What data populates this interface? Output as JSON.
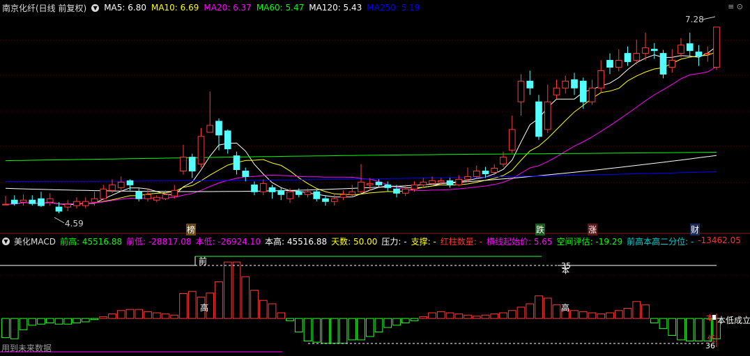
{
  "main_panel": {
    "stock_title": "南京化纤(日线 前复权)",
    "ma": [
      {
        "label": "MA5:",
        "value": "6.80",
        "color": "#ffffff"
      },
      {
        "label": "MA10:",
        "value": "6.69",
        "color": "#ffff00"
      },
      {
        "label": "MA20:",
        "value": "6.37",
        "color": "#ff00ff"
      },
      {
        "label": "MA60:",
        "value": "5.47",
        "color": "#00ff00"
      },
      {
        "label": "MA120:",
        "value": "5.43",
        "color": "#ffffff"
      },
      {
        "label": "MA250:",
        "value": "5.19",
        "color": "#0000ff"
      }
    ],
    "high_price_label": "7.28",
    "low_price_label": "4.59",
    "event_tags": [
      {
        "text": "榜",
        "color": "#ffffff",
        "bg": "#6b4a1a"
      },
      {
        "text": "跌",
        "color": "#ffffff",
        "bg": "#1a5a1a"
      },
      {
        "text": "涨",
        "color": "#ffffff",
        "bg": "#5a1a1a"
      },
      {
        "text": "财",
        "color": "#ffffff",
        "bg": "#1a2a5a"
      }
    ]
  },
  "macd_panel": {
    "title": "美化MACD",
    "metrics": [
      {
        "label": "前高:",
        "value": "45516.88",
        "color": "#00ff00"
      },
      {
        "label": "前低:",
        "value": "-28817.08",
        "color": "#ff00ff"
      },
      {
        "label": "本低:",
        "value": "-26924.10",
        "color": "#ff00ff"
      },
      {
        "label": "本高:",
        "value": "45516.88",
        "color": "#ffffff"
      },
      {
        "label": "天数:",
        "value": "50.00",
        "color": "#ffff00"
      },
      {
        "label": "压力:",
        "value": "-",
        "color": "#ffffff"
      },
      {
        "label": "支撑:",
        "value": "-",
        "color": "#ffff00"
      },
      {
        "label": "红柱数量:",
        "value": "-",
        "color": "#ff3030"
      },
      {
        "label": "横线起始价:",
        "value": "5.65",
        "color": "#ff00ff"
      },
      {
        "label": "空间评估:",
        "value": "-19.29",
        "color": "#00ff00"
      },
      {
        "label": "前高本高二分位:",
        "value": "-",
        "color": "#00d0d0"
      },
      {
        "label": "",
        "value": "-13462.05",
        "color": "#ff3030"
      }
    ],
    "annotations": {
      "qian": "前",
      "gao": "高",
      "ben": "本",
      "num_35": "35",
      "num_36": "36",
      "benchengli": "本低成立",
      "ben_small": "本",
      "di_small": "低"
    },
    "footer_note": "用到未来数据"
  },
  "window": {
    "controls": "≡ ⊙"
  },
  "chart_data": {
    "type": "candlestick",
    "y_ticks": [],
    "candles": [
      [
        4.72,
        4.72,
        4.84,
        4.72
      ],
      [
        4.78,
        4.73,
        4.85,
        4.7
      ],
      [
        4.75,
        4.78,
        4.86,
        4.7
      ],
      [
        4.78,
        4.73,
        4.85,
        4.7
      ],
      [
        4.8,
        4.7,
        4.9,
        4.68
      ],
      [
        4.75,
        4.8,
        4.88,
        4.7
      ],
      [
        4.68,
        4.62,
        4.75,
        4.59
      ],
      [
        4.68,
        4.72,
        4.78,
        4.62
      ],
      [
        4.7,
        4.76,
        4.82,
        4.66
      ],
      [
        4.7,
        4.76,
        4.82,
        4.66
      ],
      [
        4.75,
        4.8,
        4.9,
        4.7
      ],
      [
        4.8,
        4.94,
        5.0,
        4.78
      ],
      [
        4.92,
        5.0,
        5.08,
        4.88
      ],
      [
        4.96,
        5.04,
        5.12,
        4.9
      ],
      [
        5.06,
        5.0,
        5.08,
        4.92
      ],
      [
        4.9,
        4.8,
        4.95,
        4.76
      ],
      [
        4.8,
        4.86,
        4.95,
        4.76
      ],
      [
        4.78,
        4.82,
        4.85,
        4.75
      ],
      [
        4.8,
        4.86,
        4.92,
        4.78
      ],
      [
        4.84,
        4.92,
        5.0,
        4.8
      ],
      [
        5.2,
        5.4,
        5.58,
        5.15
      ],
      [
        5.4,
        5.2,
        5.45,
        5.1
      ],
      [
        5.3,
        5.7,
        5.82,
        5.25
      ],
      [
        5.76,
        5.86,
        6.35,
        5.8
      ],
      [
        5.92,
        5.72,
        5.96,
        5.5
      ],
      [
        5.78,
        5.52,
        5.8,
        5.45
      ],
      [
        5.42,
        5.22,
        5.48,
        5.15
      ],
      [
        5.2,
        5.12,
        5.25,
        5.05
      ],
      [
        5.0,
        4.9,
        5.05,
        4.85
      ],
      [
        4.9,
        5.02,
        5.08,
        4.85
      ],
      [
        4.96,
        4.9,
        5.0,
        4.8
      ],
      [
        4.92,
        4.86,
        4.96,
        4.78
      ],
      [
        4.8,
        4.9,
        4.95,
        4.74
      ],
      [
        4.9,
        4.86,
        4.95,
        4.82
      ],
      [
        4.86,
        4.9,
        4.95,
        4.82
      ],
      [
        4.9,
        4.8,
        4.93,
        4.76
      ],
      [
        4.8,
        4.76,
        4.85,
        4.7
      ],
      [
        4.76,
        4.8,
        4.86,
        4.7
      ],
      [
        4.82,
        4.86,
        4.92,
        4.78
      ],
      [
        4.86,
        4.9,
        5.0,
        4.82
      ],
      [
        4.9,
        5.04,
        5.3,
        4.88
      ],
      [
        5.0,
        5.02,
        5.1,
        4.92
      ],
      [
        5.04,
        5.0,
        5.08,
        4.96
      ],
      [
        5.0,
        4.96,
        5.05,
        4.9
      ],
      [
        4.94,
        4.88,
        5.0,
        4.82
      ],
      [
        4.88,
        4.94,
        5.0,
        4.84
      ],
      [
        4.94,
        5.0,
        5.05,
        4.9
      ],
      [
        5.0,
        5.04,
        5.1,
        4.96
      ],
      [
        5.02,
        5.06,
        5.12,
        5.0
      ],
      [
        5.04,
        5.06,
        5.1,
        5.0
      ],
      [
        5.06,
        5.0,
        5.1,
        4.96
      ],
      [
        5.0,
        5.08,
        5.14,
        4.98
      ],
      [
        5.08,
        5.12,
        5.25,
        5.04
      ],
      [
        5.12,
        5.2,
        5.28,
        5.08
      ],
      [
        5.2,
        5.16,
        5.26,
        5.1
      ],
      [
        5.18,
        5.24,
        5.3,
        5.14
      ],
      [
        5.3,
        5.4,
        5.48,
        5.26
      ],
      [
        5.5,
        5.8,
        6.0,
        5.46
      ],
      [
        6.2,
        6.5,
        6.6,
        6.0
      ],
      [
        6.5,
        6.4,
        6.65,
        6.3
      ],
      [
        6.2,
        5.7,
        6.3,
        5.65
      ],
      [
        5.8,
        6.2,
        6.45,
        5.75
      ],
      [
        6.3,
        6.4,
        6.52,
        6.24
      ],
      [
        6.4,
        6.5,
        6.58,
        6.32
      ],
      [
        6.52,
        6.4,
        6.62,
        6.3
      ],
      [
        6.5,
        6.2,
        6.55,
        6.1
      ],
      [
        6.2,
        6.4,
        6.52,
        6.16
      ],
      [
        6.4,
        6.65,
        6.8,
        6.34
      ],
      [
        6.8,
        6.7,
        6.9,
        6.6
      ],
      [
        6.7,
        6.8,
        6.96,
        6.64
      ],
      [
        6.9,
        6.78,
        7.0,
        6.72
      ],
      [
        6.8,
        6.9,
        7.1,
        6.74
      ],
      [
        6.9,
        6.98,
        7.2,
        6.8
      ],
      [
        6.96,
        6.94,
        7.05,
        6.82
      ],
      [
        6.9,
        6.6,
        6.95,
        6.54
      ],
      [
        6.7,
        6.8,
        6.96,
        6.62
      ],
      [
        6.9,
        7.02,
        7.12,
        6.84
      ],
      [
        7.04,
        6.94,
        7.2,
        6.86
      ],
      [
        6.92,
        6.86,
        7.02,
        6.72
      ],
      [
        6.9,
        6.9,
        7.0,
        6.78
      ],
      [
        6.7,
        7.28,
        7.28,
        6.66
      ]
    ],
    "ma_lines": {
      "ma5": "#ffffff",
      "ma10": "#ffff00",
      "ma20": "#ff00ff",
      "ma60": "#00ff00",
      "ma120": "#ffffff",
      "ma250": "#0000ff"
    },
    "macd": [
      -34,
      -36,
      -20,
      -12,
      -10,
      -8,
      -10,
      -10,
      -8,
      -6,
      -2,
      3,
      8,
      14,
      16,
      16,
      12,
      10,
      8,
      6,
      44,
      48,
      38,
      45,
      65,
      100,
      100,
      74,
      50,
      32,
      26,
      10,
      -4,
      -24,
      -40,
      -42,
      -44,
      -44,
      -44,
      -38,
      -38,
      -32,
      -24,
      -16,
      -12,
      -8,
      -4,
      3,
      10,
      12,
      10,
      8,
      6,
      4,
      6,
      8,
      10,
      14,
      20,
      26,
      40,
      36,
      24,
      16,
      14,
      12,
      10,
      8,
      10,
      14,
      18,
      30,
      24,
      -8,
      -18,
      -30,
      -38,
      -40,
      -40,
      -40,
      -36
    ],
    "macd_ylim": [
      -48,
      110
    ]
  }
}
